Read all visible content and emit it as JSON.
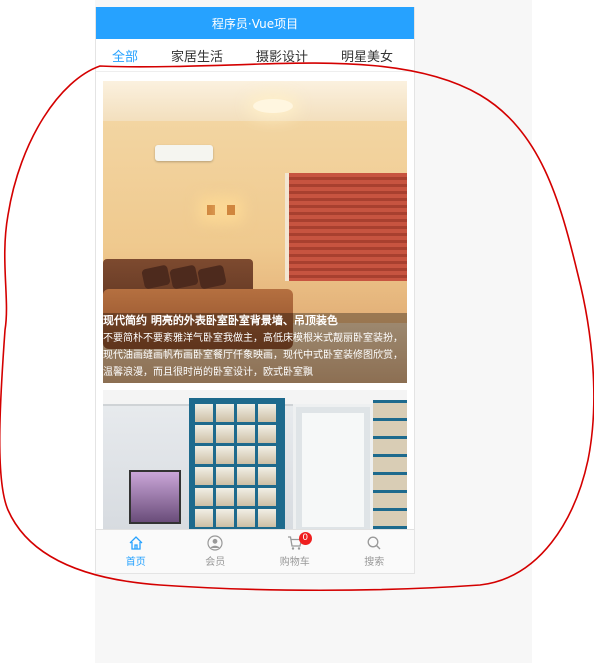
{
  "header": {
    "title": "程序员·Vue项目"
  },
  "tabs": [
    {
      "label": "全部",
      "active": true
    },
    {
      "label": "家居生活",
      "active": false
    },
    {
      "label": "摄影设计",
      "active": false
    },
    {
      "label": "明星美女",
      "active": false
    }
  ],
  "cards": [
    {
      "title": "现代简约 明亮的外表卧室卧室背景墙、吊顶装色",
      "description": "不要简朴不要紊雅洋气卧室我做主，高低床模根米式靓丽卧室装扮，现代油画缝画帆布画卧室餐厅仟象映画，现代中式卧室装修图欣赏，温馨浪漫，而且很时尚的卧室设计，欧式卧室飘"
    },
    {
      "title": "",
      "description": ""
    }
  ],
  "tabbar": {
    "items": [
      {
        "label": "首页",
        "icon": "home-icon",
        "active": true
      },
      {
        "label": "会员",
        "icon": "user-icon",
        "active": false
      },
      {
        "label": "购物车",
        "icon": "cart-icon",
        "active": false,
        "badge": "0"
      },
      {
        "label": "搜索",
        "icon": "search-icon",
        "active": false
      }
    ]
  },
  "colors": {
    "accent": "#26a2ff",
    "badge": "#ef1f1f",
    "annotation": "#d40000"
  }
}
